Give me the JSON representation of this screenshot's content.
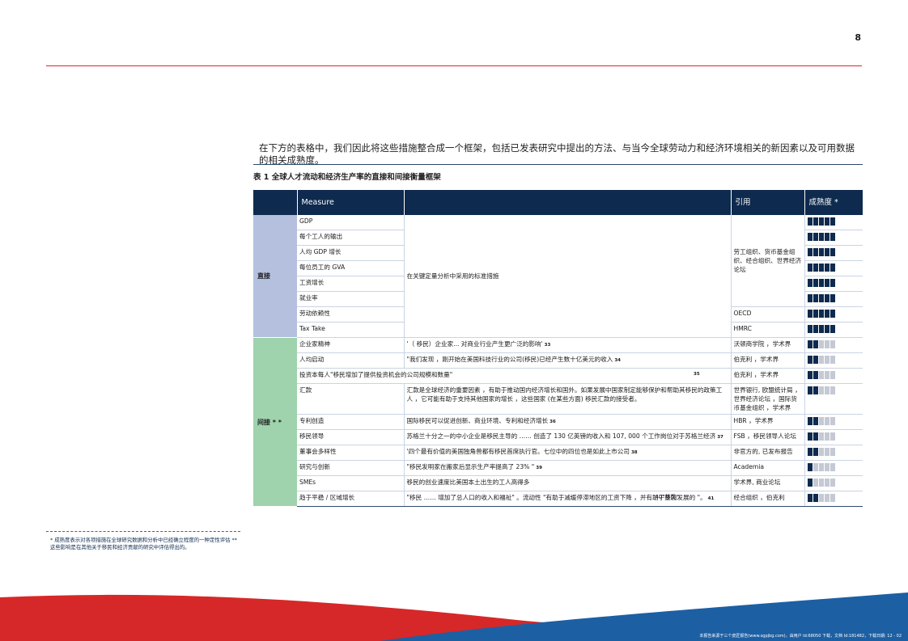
{
  "page": {
    "number": "8",
    "intro": "在下方的表格中，我们因此将这些措施整合成一个框架，包括已发表研究中提出的方法、与当今全球劳动力和经济环境相关的新因素以及可用数据的相关成熟度。",
    "table_title": "表 1 全球人才流动和经济生产率的直接和间接衡量框架"
  },
  "table": {
    "headers": {
      "measure": "Measure",
      "citation": "引用",
      "maturity": "成熟度 *"
    },
    "direct": {
      "label": "直接",
      "shared_description": "在关键定量分析中采用的标准措施",
      "rows": [
        {
          "measure": "GDP",
          "maturity": 5
        },
        {
          "measure": "每个工人的输出",
          "maturity": 5
        },
        {
          "measure": "人均 GDP 增长",
          "maturity": 5
        },
        {
          "measure": "每位员工的 GVA",
          "maturity": 5
        },
        {
          "measure": "工资增长",
          "maturity": 5
        },
        {
          "measure": "就业率",
          "maturity": 5
        },
        {
          "measure": "劳动依赖性",
          "citation": "OECD",
          "maturity": 5
        },
        {
          "measure": "Tax Take",
          "citation": "HMRC",
          "maturity": 5
        }
      ],
      "group_citation": "劳工组织、货币基金组织、经合组织、世界经济论坛"
    },
    "indirect": {
      "label": "间接 * *",
      "rows": [
        {
          "measure": "企业家精神",
          "description": "'（ 移民）企业家... 对商业行业产生更广泛的影响'",
          "ref": "33",
          "citation": "沃顿商学院 ，学术界",
          "maturity": 2
        },
        {
          "measure": "人均启动",
          "description": "\"我们发现 ，刚开始在美国科技行业的公司(移民)已经产生数十亿美元的收入",
          "ref": "34",
          "citation": "伯克利 ，学术界",
          "maturity": 2
        },
        {
          "measure": "投资本每人\"移民增加了提供投资机会的公司规模和数量\"",
          "description": "",
          "ref": "35",
          "citation": "伯克利 ，学术界",
          "maturity": 2
        },
        {
          "measure": "汇款",
          "description": "汇款是全球经济的重要因素 ，有助于推动国内经济增长和国外。如果发展中国家制定能够保护和帮助其移民的政策工人 ，它可能有助于支持其他国家的增长 ，这些国家 (在某些方面) 移民汇款的接受者。",
          "ref": "",
          "citation": "世界银行, 欧盟统计局 ，世界经济论坛 ，国际货币基金组织 ，学术界",
          "maturity": 2
        },
        {
          "measure": "专利创造",
          "description": "国际移民可以促进创新、商业环境、专利和经济增长",
          "ref": "36",
          "citation": "HBR ，学术界",
          "maturity": 2
        },
        {
          "measure": "移民领导",
          "description": "苏格兰十分之一的中小企业是移民主导的 …… 创造了 130 亿英镑的收入和 107, 000 个工作岗位对于苏格兰经济",
          "ref": "37",
          "citation": "FSB ，移民领导人论坛",
          "maturity": 2
        },
        {
          "measure": "董事会多样性",
          "description": "'四个最有价值的美国独角兽都有移民首席执行官。七位中的四位也是如此上市公司",
          "ref": "38",
          "citation": "非官方的, 已发布报告",
          "maturity": 2
        },
        {
          "measure": "研究与创新",
          "description": "\"移民发明家在搬家后显示生产率提高了 23% \"",
          "ref": "39",
          "citation": "Academia",
          "maturity": 1
        },
        {
          "measure": "SMEs",
          "description": "移民的创业速度比美国本土出生的工人高得多",
          "ref": "",
          "citation": "学术界, 商业论坛",
          "maturity": 1
        },
        {
          "measure": "趋于平稳 / 区域增长",
          "description": "\"移民 …… 增加了总人口的收入和福祉\" 。流动性 \"有助于减缓停滞地区的工资下降 ，并有助于蓬勃发展的 \"。",
          "ref": "41",
          "extra": "40\"移民\"",
          "citation": "经合组织 ，伯克利",
          "maturity": 2
        }
      ]
    }
  },
  "footnote": "* 成熟度表示对各项措施在全球研究数据和分析中已经确立程度的一种定性评估 ** 这些影响是在其他关于移民和经济贡献的研究中评估得出的。",
  "footer_text": "本报告来源于三个皮匠报告(www.sgpjbg.com)，由用户 Id:68050 下载，文档 Id:181482，下载日期: 12 - 02",
  "colors": {
    "accent_red": "#d62828",
    "header_navy": "#0e2a4e",
    "direct_band": "#b4c0de",
    "indirect_band": "#9fd3ad",
    "wave_blue": "#1d5fa3"
  }
}
